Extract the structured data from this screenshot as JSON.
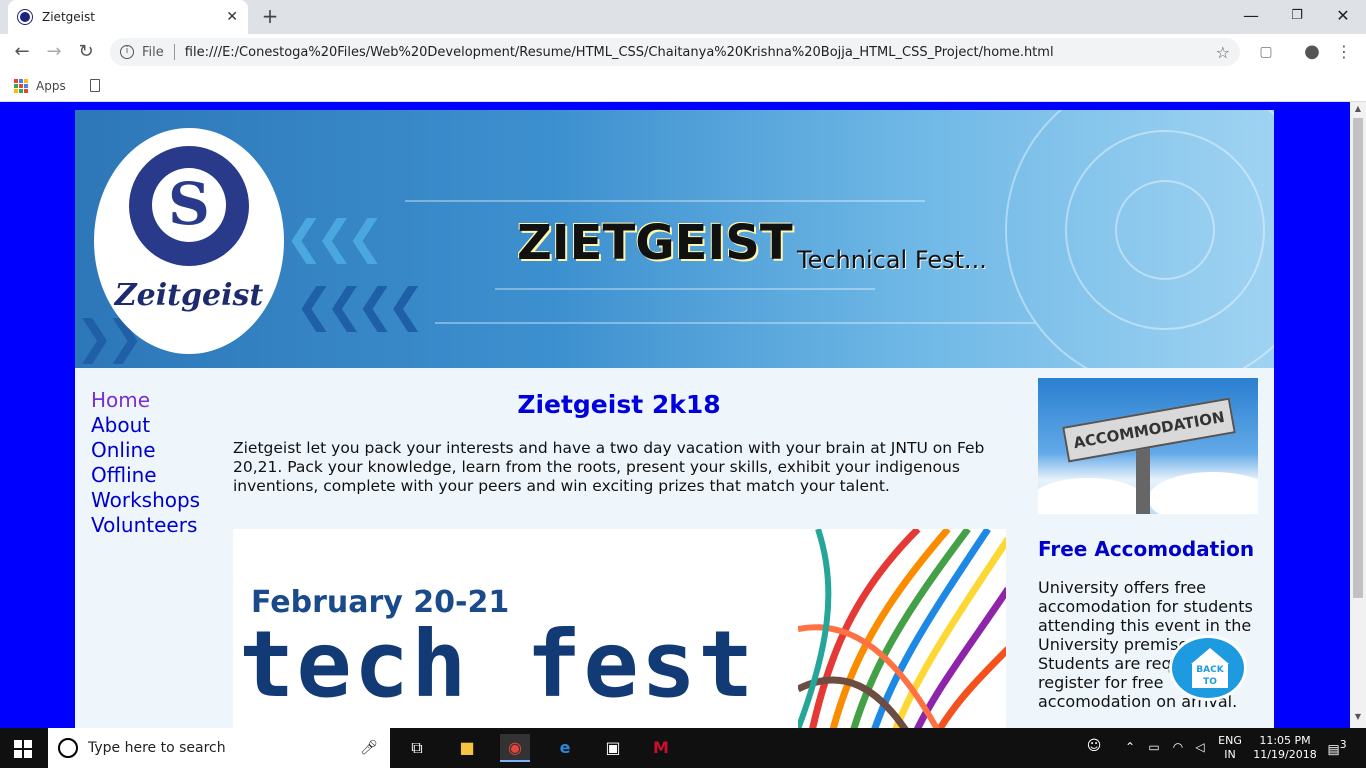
{
  "browser": {
    "tab_title": "Zietgeist",
    "tab_close": "✕",
    "new_tab": "+",
    "url_label": "File",
    "url": "file:///E:/Conestoga%20Files/Web%20Development/Resume/HTML_CSS/Chaitanya%20Krishna%20Bojja_HTML_CSS_Project/home.html",
    "bookmarks_apps": "Apps",
    "back": "←",
    "forward": "→",
    "reload": "↻",
    "star": "☆",
    "minimize": "—",
    "maximize": "❐",
    "close": "✕"
  },
  "site": {
    "logo_word": "Zeitgeist",
    "logo_letter": "S",
    "brand_title": "ZIETGEIST",
    "brand_subtitle": "Technical Fest...",
    "nav": [
      "Home",
      "About",
      "Online",
      "Offline",
      "Workshops",
      "Volunteers"
    ],
    "main_title": "Zietgeist 2k18",
    "intro": "Zietgeist let you pack your interests and have a two day vacation with your brain at JNTU on Feb 20,21. Pack your knowledge, learn from the roots, present your skills, exhibit your indigenous inventions, complete with your peers and win exciting prizes that match your talent.",
    "poster_date": "February 20-21",
    "poster_word": "tech fest",
    "acc_sign": "ACCOMMODATION",
    "side_title": "Free Accomodation",
    "side_text": "University offers free accomodation for students attending this event in the University premises. Students are requested to register for free accomodation on arrival.",
    "back_to_top": "BACK TO TOP"
  },
  "taskbar": {
    "search_placeholder": "Type here to search",
    "lang_top": "ENG",
    "lang_bottom": "IN",
    "time": "11:05 PM",
    "date": "11/19/2018",
    "notifications": "3"
  },
  "colors": {
    "page_bg": "#0000ff",
    "link": "#0000cc",
    "visited_link": "#7a2fd0",
    "title": "#0000dd"
  }
}
